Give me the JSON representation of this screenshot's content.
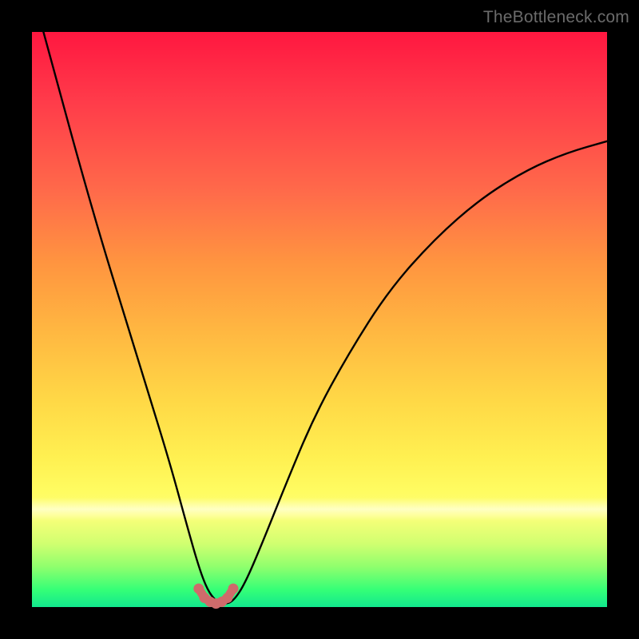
{
  "watermark": "TheBottleneck.com",
  "chart_data": {
    "type": "line",
    "title": "",
    "xlabel": "",
    "ylabel": "",
    "xlim": [
      0,
      100
    ],
    "ylim": [
      0,
      100
    ],
    "legend": null,
    "grid": false,
    "series": [
      {
        "name": "bottleneck-curve",
        "color": "#000000",
        "x": [
          2,
          5,
          8,
          12,
          16,
          20,
          24,
          27,
          29,
          30.5,
          32,
          33.5,
          35,
          37,
          40,
          44,
          49,
          55,
          62,
          70,
          78,
          86,
          93,
          100
        ],
        "y": [
          100,
          89,
          78,
          64,
          51,
          38,
          25,
          14,
          7,
          3,
          1,
          0.5,
          1,
          4,
          11,
          21,
          33,
          44,
          55,
          64,
          71,
          76,
          79,
          81
        ]
      }
    ],
    "markers": {
      "name": "valley-dots",
      "color": "#cf6b6b",
      "x": [
        29,
        30,
        31,
        32,
        33,
        34,
        35
      ],
      "y": [
        3.2,
        1.6,
        0.9,
        0.6,
        0.9,
        1.6,
        3.2
      ]
    },
    "gradient_stops_pct": [
      0,
      12,
      28,
      40,
      52,
      64,
      74,
      80,
      84,
      89,
      93,
      97,
      100
    ],
    "gradient_colors": [
      "#ff1740",
      "#ff3b4a",
      "#ff6b4a",
      "#ff9440",
      "#ffb741",
      "#ffd846",
      "#fff051",
      "#fffc61",
      "#fdff7a",
      "#d0ff70",
      "#8fff6d",
      "#35ff77",
      "#12e88e"
    ]
  }
}
